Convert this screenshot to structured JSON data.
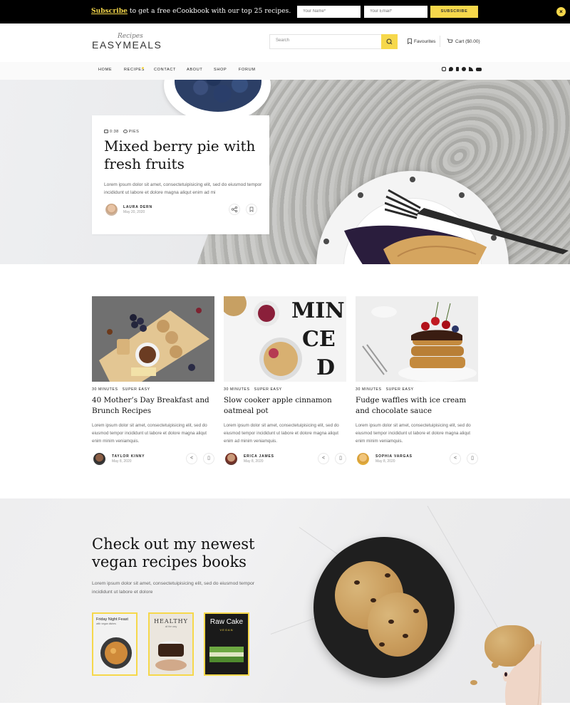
{
  "topbar": {
    "subscribe_link": "Subscribe",
    "promo_text": " to get a free eCookbook with our top 25 recipes.",
    "name_placeholder": "Your Name*",
    "email_placeholder": "Your Email*",
    "subscribe_button": "SUBSCRIBE",
    "close_icon": "×"
  },
  "header": {
    "logo_script": "Recipes",
    "logo": "EASYMEALS",
    "search_placeholder": "Search",
    "favourites": "Favourites",
    "cart": "Cart ($0.00)"
  },
  "nav": {
    "items": [
      "HOME",
      "RECIPES",
      "CONTACT",
      "ABOUT",
      "SHOP",
      "FORUM"
    ],
    "social_icons": [
      "instagram-icon",
      "twitter-icon",
      "facebook-icon",
      "pinterest-icon",
      "rss-icon",
      "youtube-icon"
    ]
  },
  "hero": {
    "time": "0:38",
    "category": "PIES",
    "title": "Mixed berry pie with fresh fruits",
    "excerpt": "Lorem ipsum dolor sit amet, consectetuipisicing elit, sed do eiusmod tempor incididunt ut labore et dolore magna aliqut enim ad mi",
    "author": "LAURA DERN",
    "date": "May 20, 2020"
  },
  "recipes": [
    {
      "time": "30 MINUTES",
      "difficulty": "SUPER EASY",
      "title": "40 Mother’s Day Breakfast and Brunch Recipes",
      "excerpt": "Lorem ipsum dolor sit amet, consectetuipisicing elit, sed do eiusmod tempor incididunt ut labore et dolore magna aliqut enim minim veniamquis.",
      "author": "TAYLOR KINNY",
      "date": "May 8, 2020"
    },
    {
      "time": "30 MINUTES",
      "difficulty": "SUPER EASY",
      "title": "Slow cooker apple cinnamon oatmeal pot",
      "excerpt": "Lorem ipsum dolor sit amet, consectetuipisicing elit, sed do eiusmod tempor incididunt ut labore et dolore magna aliqut enim ad minim veniamquis.",
      "author": "ERICA JAMES",
      "date": "May 8, 2020"
    },
    {
      "time": "30 MINUTES",
      "difficulty": "SUPER EASY",
      "title": "Fudge waffles with ice cream and chocolate sauce",
      "excerpt": "Lorem ipsum dolor sit amet, consectetuipisicing elit, sed do eiusmod tempor incididunt ut labore et dolore magna aliqut enim minim veniamquis.",
      "author": "SOPHIA VARGAS",
      "date": "May 8, 2020"
    }
  ],
  "books": {
    "heading": "Check out my newest vegan recipes books",
    "excerpt": "Lorem ipsum dolor sit amet, consectetuipisicing elit, sed do eiusmod tempor incididunt ut labore et dolore",
    "items": [
      {
        "title": "Friday Night Feast",
        "subtitle": "with vegan dishes"
      },
      {
        "title": "HEALTHY",
        "subtitle": "all the way"
      },
      {
        "title": "Raw Cake",
        "subtitle": "VEGAN"
      }
    ]
  },
  "colors": {
    "accent": "#f6d84b",
    "topbar": "#000000"
  }
}
